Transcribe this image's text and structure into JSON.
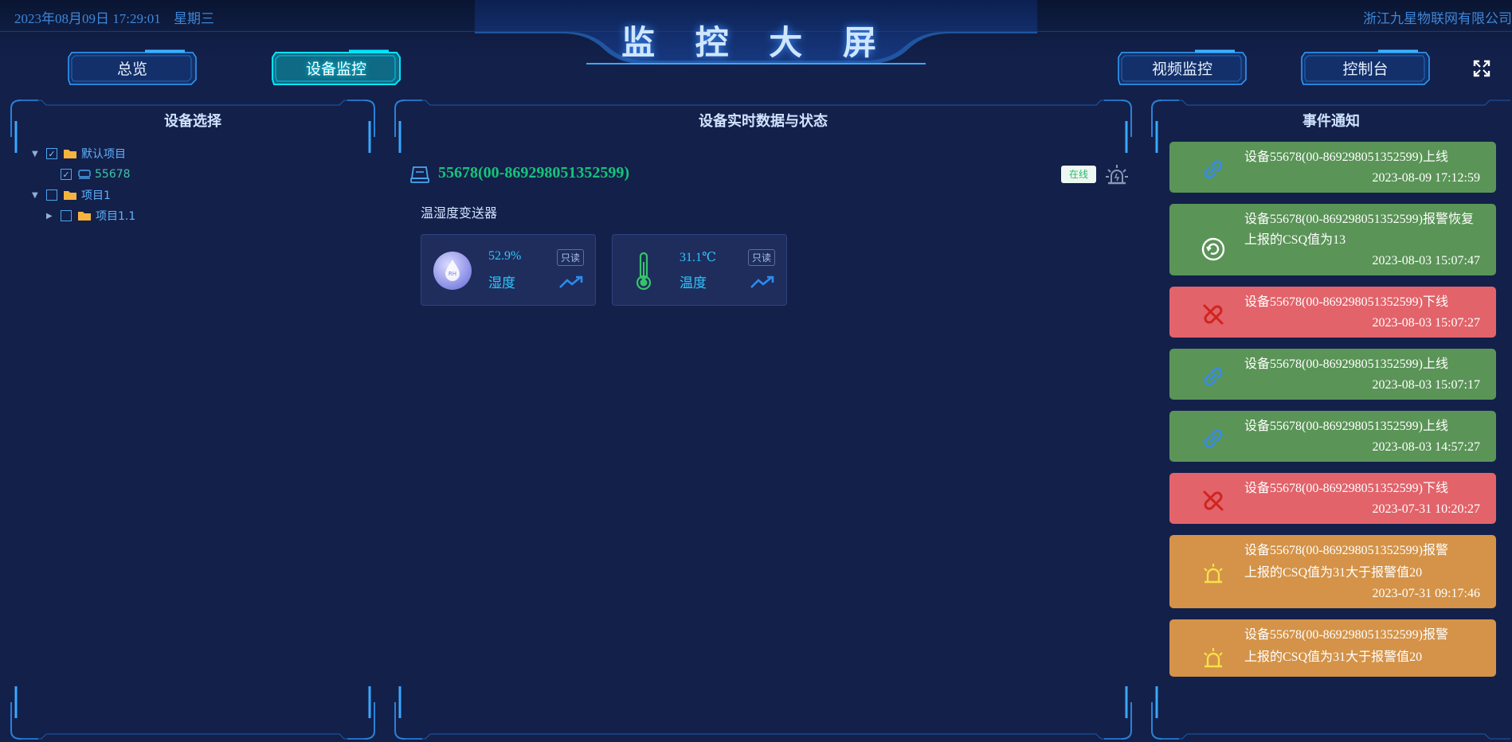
{
  "header": {
    "date": "2023年08月09日 17:29:01",
    "weekday": "星期三",
    "title": "监 控 大 屏",
    "company": "浙江九星物联网有限公司"
  },
  "nav": {
    "overview": "总览",
    "device_monitor": "设备监控",
    "video_monitor": "视频监控",
    "console": "控制台"
  },
  "left_panel": {
    "title": "设备选择",
    "tree": [
      {
        "label": "默认项目",
        "checked": "✓"
      },
      {
        "label": "55678",
        "checked": "✓"
      },
      {
        "label": "项目1",
        "checked": ""
      },
      {
        "label": "项目1.1",
        "checked": ""
      }
    ]
  },
  "center_panel": {
    "title": "设备实时数据与状态",
    "device_name": "55678(00-869298051352599)",
    "status": "在线",
    "device_type": "温湿度变送器",
    "cards": [
      {
        "value": "52.9%",
        "name": "湿度",
        "mode": "只读"
      },
      {
        "value": "31.1℃",
        "name": "温度",
        "mode": "只读"
      }
    ]
  },
  "right_panel": {
    "title": "事件通知",
    "events": [
      {
        "type": "online",
        "text": "设备55678(00-869298051352599)上线",
        "detail": "",
        "time": "2023-08-09 17:12:59"
      },
      {
        "type": "recover",
        "text": "设备55678(00-869298051352599)报警恢复",
        "detail": "上报的CSQ值为13",
        "time": "2023-08-03 15:07:47"
      },
      {
        "type": "offline",
        "text": "设备55678(00-869298051352599)下线",
        "detail": "",
        "time": "2023-08-03 15:07:27"
      },
      {
        "type": "online",
        "text": "设备55678(00-869298051352599)上线",
        "detail": "",
        "time": "2023-08-03 15:07:17"
      },
      {
        "type": "online",
        "text": "设备55678(00-869298051352599)上线",
        "detail": "",
        "time": "2023-08-03 14:57:27"
      },
      {
        "type": "offline",
        "text": "设备55678(00-869298051352599)下线",
        "detail": "",
        "time": "2023-07-31 10:20:27"
      },
      {
        "type": "alarm",
        "text": "设备55678(00-869298051352599)报警",
        "detail": "上报的CSQ值为31大于报警值20",
        "time": "2023-07-31 09:17:46"
      },
      {
        "type": "alarm",
        "text": "设备55678(00-869298051352599)报警",
        "detail": "上报的CSQ值为31大于报警值20",
        "time": ""
      }
    ]
  },
  "colors": {
    "background": "#13204a",
    "online": "#5a9457",
    "offline": "#e2636a",
    "alarm": "#d49348",
    "accent": "#00e5ff",
    "device_name": "#15c478"
  },
  "icons": {
    "online": "link-icon",
    "recover": "refresh-icon",
    "offline": "unlink-icon",
    "alarm": "alarm-bell-icon"
  }
}
